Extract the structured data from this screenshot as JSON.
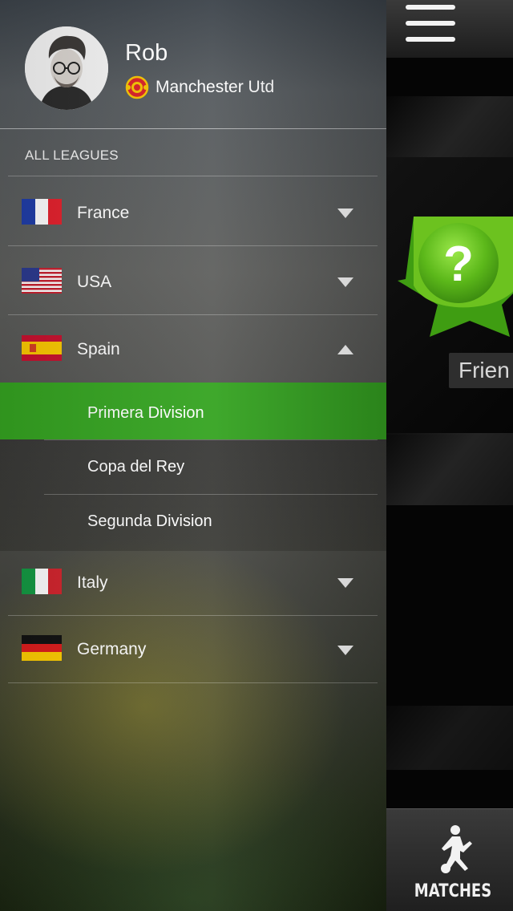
{
  "profile": {
    "name": "Rob",
    "club": "Manchester Utd"
  },
  "menu": {
    "section_title": "ALL LEAGUES",
    "countries": [
      {
        "label": "France",
        "expanded": false
      },
      {
        "label": "USA",
        "expanded": false
      },
      {
        "label": "Spain",
        "expanded": true
      },
      {
        "label": "Italy",
        "expanded": false
      },
      {
        "label": "Germany",
        "expanded": false
      }
    ],
    "spain_leagues": [
      {
        "label": "Primera Division",
        "selected": true
      },
      {
        "label": "Copa del Rey",
        "selected": false
      },
      {
        "label": "Segunda Division",
        "selected": false
      }
    ]
  },
  "background_app": {
    "card_label": "Frien",
    "tab_label": "MATCHES"
  },
  "colors": {
    "accent_green": "#35a421",
    "badge_green": "#6cc21f"
  },
  "icons": [
    "hamburger-icon",
    "chevron-down-icon",
    "chevron-up-icon",
    "mystery-badge-icon",
    "soccer-player-icon",
    "club-crest-icon"
  ]
}
